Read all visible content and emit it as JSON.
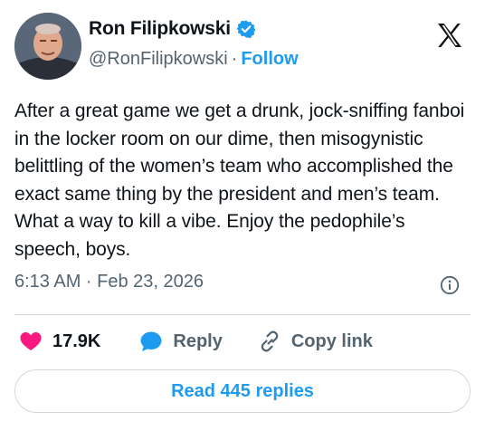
{
  "author": {
    "name": "Ron Filipkowski",
    "handle": "@RonFilipkowski",
    "separator": "·",
    "follow_label": "Follow"
  },
  "tweet": {
    "text": "After a great game we get a drunk, jock-sniffing fanboi in the locker room on our dime, then misogynistic belittling of the women’s team who accomplished the exact same thing by the president and men’s team. What a way to kill a vibe. Enjoy the pedophile’s speech, boys.",
    "timestamp": "6:13 AM · Feb 23, 2026"
  },
  "actions": {
    "like_count": "17.9K",
    "reply_label": "Reply",
    "copy_link_label": "Copy link"
  },
  "footer": {
    "read_replies_label": "Read 445 replies"
  },
  "colors": {
    "accent": "#1d9bf0",
    "like": "#f91880",
    "text_primary": "#0f1419",
    "text_secondary": "#536471",
    "border": "#cfd9de"
  },
  "icons": {
    "verified": "verified-badge-icon",
    "logo": "x-logo-icon",
    "info": "info-icon",
    "like": "heart-icon",
    "reply": "speech-bubble-icon",
    "copy": "link-icon"
  }
}
